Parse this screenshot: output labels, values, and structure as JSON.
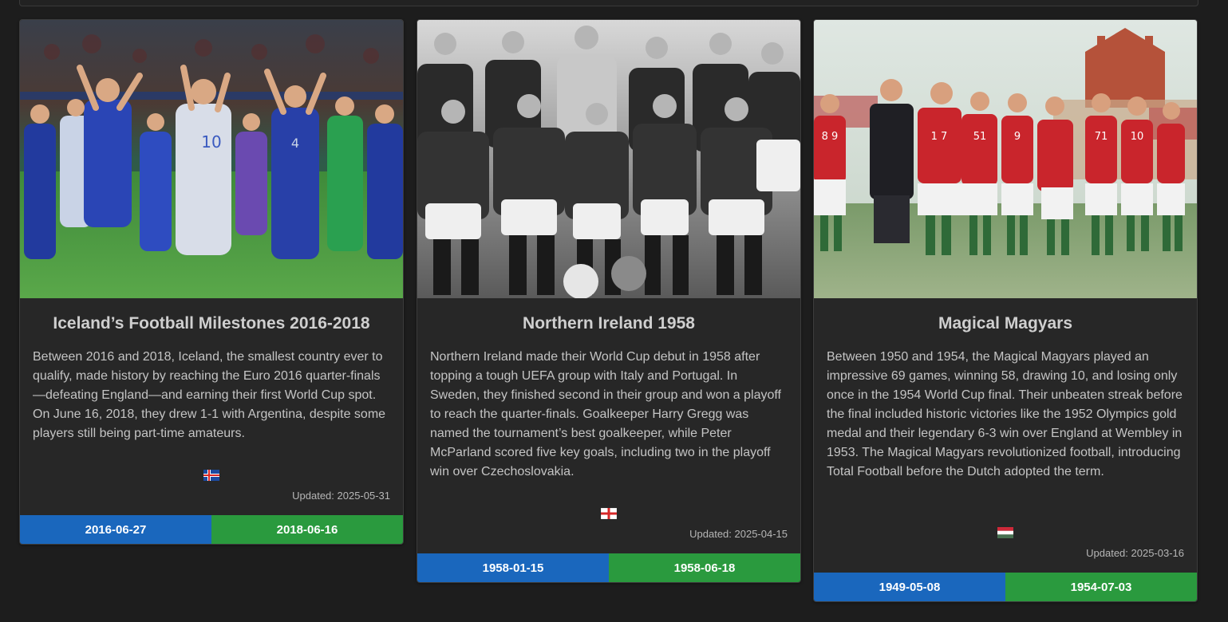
{
  "colors": {
    "start_date_bg": "#1a67bd",
    "end_date_bg": "#2a9a3e",
    "card_bg": "#272727",
    "page_bg": "#1d1d1d"
  },
  "cards": [
    {
      "title": "Iceland’s Football Milestones 2016-2018",
      "image_subject": "Iceland team celebrating in blue kits",
      "description": "Between 2016 and 2018, Iceland, the smallest country ever to qualify, made history by reaching the Euro 2016 quarter-finals—defeating England—and earning their first World Cup spot. On June 16, 2018, they drew 1-1 with Argentina, despite some players still being part-time amateurs.",
      "flag_icon": "iceland-flag-icon",
      "updated": "Updated: 2025-05-31",
      "start_date": "2016-06-27",
      "end_date": "2018-06-16"
    },
    {
      "title": "Northern Ireland 1958",
      "image_subject": "Black and white team photo of Northern Ireland squad",
      "description": "Northern Ireland made their World Cup debut in 1958 after topping a tough UEFA group with Italy and Portugal. In Sweden, they finished second in their group and won a playoff to reach the quarter-finals. Goalkeeper Harry Gregg was named the tournament’s best goalkeeper, while Peter McParland scored five key goals, including two in the playoff win over Czechoslovakia.",
      "flag_icon": "northern-ireland-flag-icon",
      "updated": "Updated: 2025-04-15",
      "start_date": "1958-01-15",
      "end_date": "1958-06-18"
    },
    {
      "title": "Magical Magyars",
      "image_subject": "Hungarian team lined up in red shirts with castle behind",
      "description": "Between 1950 and 1954, the Magical Magyars played an impressive 69 games, winning 58, drawing 10, and losing only once in the 1954 World Cup final. Their unbeaten streak before the final included historic victories like the 1952 Olympics gold medal and their legendary 6-3 win over England at Wembley in 1953. The Magical Magyars revolutionized football, introducing Total Football before the Dutch adopted the term.",
      "flag_icon": "hungary-flag-icon",
      "updated": "Updated: 2025-03-16",
      "start_date": "1949-05-08",
      "end_date": "1954-07-03"
    }
  ]
}
